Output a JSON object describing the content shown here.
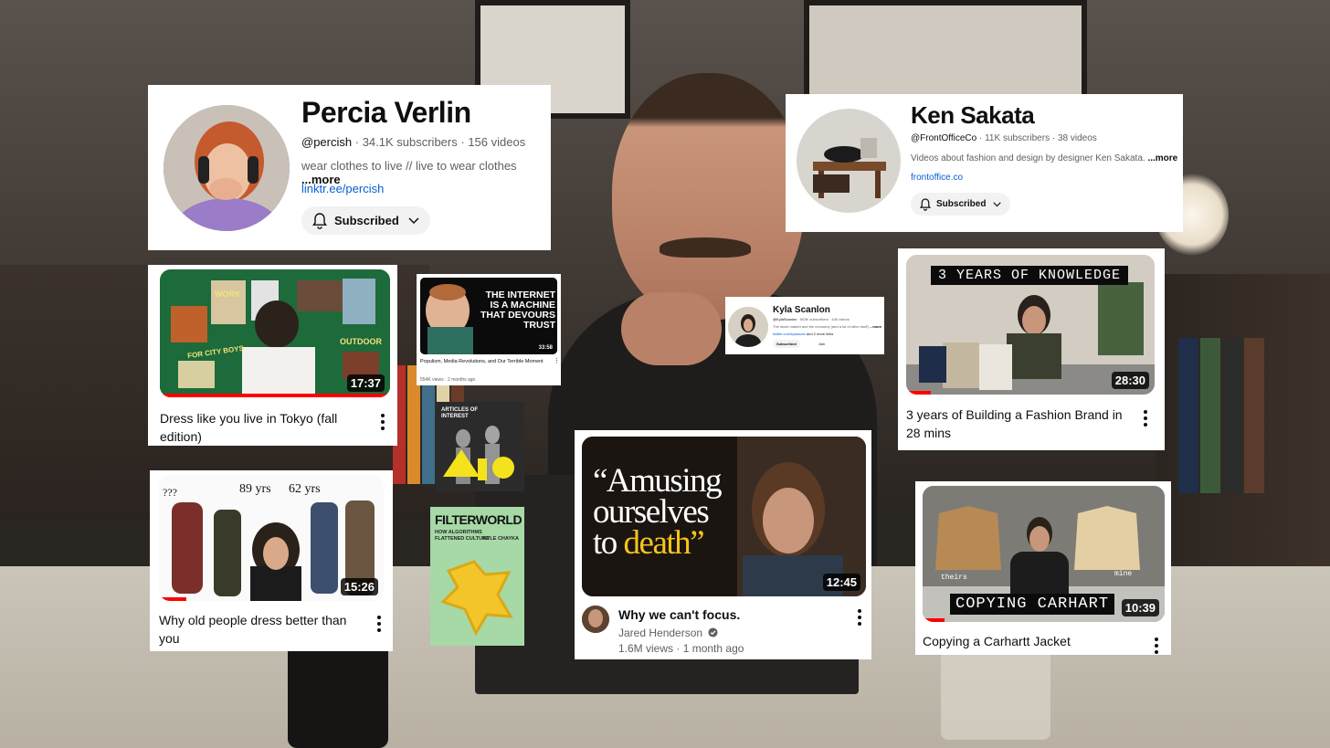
{
  "channels": {
    "percia": {
      "name": "Percia Verlin",
      "handle": "@percish",
      "subscribers": "34.1K subscribers",
      "videos": "156 videos",
      "description": "wear clothes to live // live to wear clothes",
      "more": "...more",
      "link": "linktr.ee/percish",
      "subscribed_label": "Subscribed"
    },
    "ken": {
      "name": "Ken Sakata",
      "handle": "@FrontOfficeCo",
      "subscribers": "11K subscribers",
      "videos": "38 videos",
      "description": "Videos about fashion and design by designer Ken Sakata.",
      "more": "...more",
      "link": "frontoffice.co",
      "subscribed_label": "Subscribed"
    },
    "kyla": {
      "name": "Kyla Scanlon",
      "handle": "@KylaScanlon",
      "subscribers": "653K subscribers",
      "videos": "445 videos",
      "description": "The stock market and the economy (and a lot of other stuff)",
      "more": "...more",
      "link": "twitter.com/kylascan",
      "link_suffix": "and 2 more links",
      "subscribed_label": "Subscribed",
      "join_label": "Join"
    }
  },
  "videos": {
    "tokyo": {
      "title": "Dress like you live in Tokyo (fall edition)",
      "duration": "17:37",
      "progress": 1.0,
      "thumb_words": [
        "WORK",
        "OUTDOOR",
        "FOR CITY BOYS"
      ]
    },
    "internet": {
      "title": "Populism, Media Revolutions, and Our Terrible Moment",
      "views": "554K views",
      "age": "2 months ago",
      "duration": "33:58",
      "thumb_text": "THE INTERNET IS A MACHINE THAT DEVOURS TRUST"
    },
    "old_people": {
      "title": "Why old people dress better than you",
      "duration": "15:26",
      "progress": 0.12,
      "thumb_words": [
        "???",
        "89 yrs",
        "62 yrs"
      ]
    },
    "focus": {
      "title": "Why we can't focus.",
      "channel": "Jared Henderson",
      "views": "1.6M views",
      "age": "1 month ago",
      "duration": "12:45",
      "thumb_line1": "“Amusing",
      "thumb_line2": "ourselves",
      "thumb_line3": "to ",
      "thumb_line3_accent": "death”"
    },
    "fashion_brand": {
      "title": "3 years of Building a Fashion Brand in 28 mins",
      "duration": "28:30",
      "progress": 0.1,
      "thumb_banner": "3 YEARS OF KNOWLEDGE"
    },
    "carhartt": {
      "title": "Copying a Carhartt Jacket",
      "duration": "10:39",
      "progress": 0.09,
      "thumb_banner": "COPYING CARHART",
      "thumb_left": "theirs",
      "thumb_right": "mine"
    }
  },
  "books": {
    "articles": {
      "title": "ARTICLES OF INTEREST"
    },
    "filterworld": {
      "title": "FILTERWORLD",
      "subtitle": "HOW ALGORITHMS FLATTENED CULTURE",
      "author": "KYLE CHAYKA"
    }
  },
  "colors": {
    "yt_red": "#ff0000",
    "link_blue": "#065fd4",
    "meta_gray": "#606060",
    "death_yellow": "#f5c518",
    "filterworld_green": "#a6d9a6"
  },
  "icons": [
    "bell-icon",
    "chevron-down-icon",
    "more-vert-icon",
    "verified-icon"
  ]
}
